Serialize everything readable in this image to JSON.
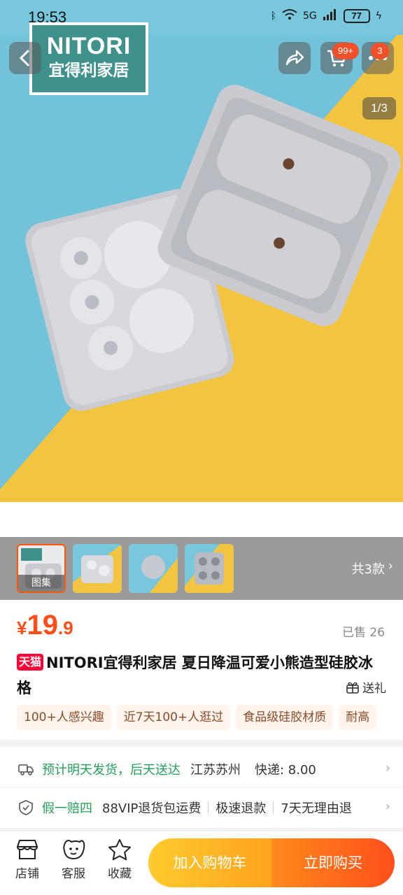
{
  "status_bar": {
    "time": "19:53",
    "network": "5G",
    "battery": "77"
  },
  "brand_logo": {
    "line1": "NITORI",
    "line2": "宜得利家居"
  },
  "header": {
    "cart_badge": "99+",
    "more_badge": "3",
    "page_indicator": "1/3"
  },
  "gallery": {
    "thumb_label": "图集",
    "variant_count": "共3款",
    "arrow": "›"
  },
  "product": {
    "currency": "¥",
    "price_int": "19",
    "price_dec": ".9",
    "sold": "已售 26",
    "store_badge": "天猫",
    "title": "NITORI宜得利家居 夏日降温可爱小熊造型硅胶冰格",
    "gift": "送礼",
    "tags": [
      "100+人感兴趣",
      "近7天100+人逛过",
      "食品级硅胶材质",
      "耐高"
    ]
  },
  "service": {
    "shipping": "预计明天发货，后天送达",
    "origin": "江苏苏州",
    "fee": "快递: 8.00",
    "guarantee": "假一赔四",
    "items": [
      "88VIP退货包运费",
      "极速退款",
      "7天无理由退"
    ],
    "arrow": "›"
  },
  "bottom": {
    "store": "店铺",
    "service": "客服",
    "favorite": "收藏",
    "add_to_cart": "加入购物车",
    "buy_now": "立即购买"
  },
  "colors": {
    "price": "#ff4d1a",
    "tmall": "#ff0036",
    "brand_teal": "#3f928c",
    "service_green": "#23a05a",
    "cart_gradient": "#ffa31c",
    "buy_gradient": "#ff4f1c"
  }
}
